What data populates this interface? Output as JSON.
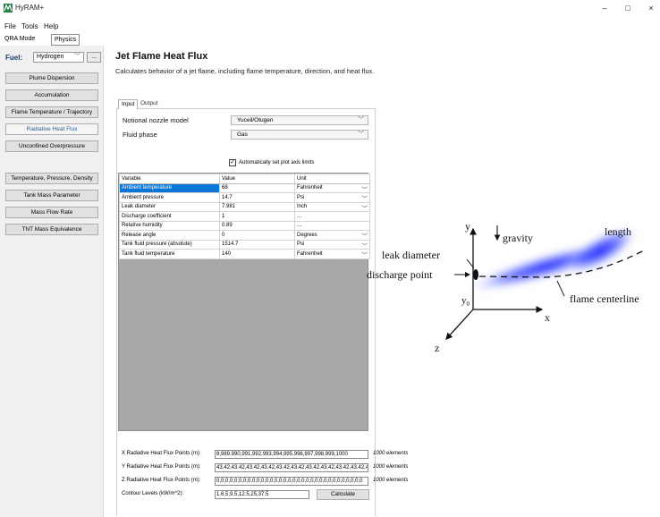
{
  "window": {
    "title": "HyRAM+",
    "minimize": "–",
    "maximize": "□",
    "close": "×",
    "logo_icon": "hyram-logo-icon"
  },
  "menu": [
    "File",
    "Tools",
    "Help"
  ],
  "mode_tabs": {
    "qra": "QRA Mode",
    "physics": "Physics"
  },
  "fuel": {
    "label": "Fuel:",
    "value": "Hydrogen",
    "more": "..."
  },
  "nav": {
    "group1": [
      "Plume Dispersion",
      "Accumulation",
      "Flame Temperature / Trajectory",
      "Radiative Heat Flux",
      "Unconfined Overpressure"
    ],
    "group2": [
      "Temperature, Pressure, Density",
      "Tank Mass Parameter",
      "Mass Flow Rate",
      "TNT Mass Equivalence"
    ],
    "active": "Radiative Heat Flux"
  },
  "page": {
    "title": "Jet Flame Heat Flux",
    "description": "Calculates behavior of a jet flame, including flame temperature, direction, and heat flux."
  },
  "subtabs": {
    "input": "Input",
    "output": "Output"
  },
  "settings": {
    "nozzle_label": "Notional nozzle model",
    "nozzle_value": "Yuceil/Otugen",
    "phase_label": "Fluid phase",
    "phase_value": "Gas",
    "auto_limits_label": "Automatically set plot axis limits",
    "auto_limits_checked": "✓"
  },
  "grid": {
    "headers": {
      "variable": "Variable",
      "value": "Value",
      "unit": "Unit"
    },
    "rows": [
      {
        "variable": "Ambient temperature",
        "value": "68",
        "unit": "Fahrenheit"
      },
      {
        "variable": "Ambient pressure",
        "value": "14.7",
        "unit": "Psi"
      },
      {
        "variable": "Leak diameter",
        "value": "7.981",
        "unit": "Inch"
      },
      {
        "variable": "Discharge coefficient",
        "value": "1",
        "unit": "..."
      },
      {
        "variable": "Relative humidity",
        "value": "0.89",
        "unit": "..."
      },
      {
        "variable": "Release angle",
        "value": "0",
        "unit": "Degrees"
      },
      {
        "variable": "Tank fluid pressure (absolute)",
        "value": "1514.7",
        "unit": "Psi"
      },
      {
        "variable": "Tank fluid temperature",
        "value": "140",
        "unit": "Fahrenheit"
      }
    ]
  },
  "bottom": {
    "x_label": "X Radiative Heat Flux Points (m):",
    "x_value": "8,989,990,991,992,993,994,995,996,997,998,999,1000",
    "x_note": "1000 elements",
    "y_label": "Y Radiative Heat Flux Points (m):",
    "y_value": "43.42,43.42,43.42,43.42,43.42,43.42,43.42,43.42,43.42,43.42,43.42",
    "y_note": "1000 elements",
    "z_label": "Z Radiative Heat Flux Points (m):",
    "z_value": "0,0,0,0,0,0,0,0,0,0,0,0,0,0,0,0,0,0,0,0,0,0,0,0,0,0,0,0,0,0,0,0,0",
    "z_note": "1000 elements",
    "contour_label": "Contour Levels (kW/m^2):",
    "contour_value": "1.6,5,9.5,12.5,25,37.5",
    "calculate": "Calculate"
  },
  "diagram": {
    "y": "y",
    "x": "x",
    "z": "z",
    "gravity": "gravity",
    "length": "length",
    "leak_diameter": "leak diameter",
    "discharge_point": "discharge point",
    "flame_centerline": "flame centerline",
    "y0": "y",
    "y0_sub": "0"
  }
}
